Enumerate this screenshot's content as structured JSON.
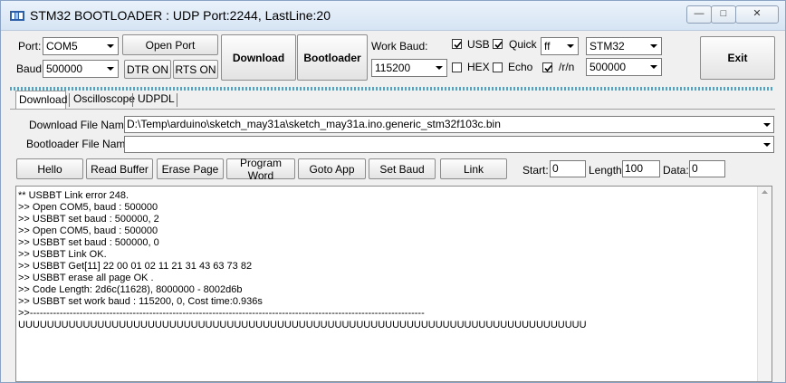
{
  "window": {
    "title": "STM32 BOOTLOADER : UDP Port:2244, LastLine:20",
    "minimize_glyph": "—",
    "maximize_glyph": "□",
    "close_glyph": "✕"
  },
  "toolbar": {
    "port_label": "Port:",
    "port_value": "COM5",
    "baud_label": "Baud:",
    "baud_value": "500000",
    "open_port_label": "Open Port",
    "dtr_label": "DTR ON",
    "rts_label": "RTS ON",
    "download_label": "Download",
    "bootloader_label": "Bootloader",
    "work_baud_label": "Work Baud:",
    "work_baud_value": "115200",
    "usb_label": "USB",
    "usb_checked": true,
    "quick_label": "Quick",
    "quick_checked": true,
    "quick_value": "ff",
    "hex_label": "HEX",
    "hex_checked": false,
    "echo_label": "Echo",
    "echo_checked": false,
    "rn_label": "/r/n",
    "rn_checked": true,
    "chip_value": "STM32",
    "chip_baud_value": "500000",
    "exit_label": "Exit"
  },
  "tabs": [
    {
      "label": "Download",
      "active": true
    },
    {
      "label": "Oscilloscope",
      "active": false
    },
    {
      "label": "UDPDL",
      "active": false
    }
  ],
  "files": {
    "download_label": "Download File Name:",
    "download_value": "D:\\Temp\\arduino\\sketch_may31a\\sketch_may31a.ino.generic_stm32f103c.bin",
    "bootloader_label": "Bootloader File Name:",
    "bootloader_value": ""
  },
  "actions": {
    "hello": "Hello",
    "read_buffer": "Read Buffer",
    "erase_page": "Erase Page",
    "program_word": "Program Word",
    "goto_app": "Goto App",
    "set_baud": "Set Baud",
    "link": "Link",
    "start_label": "Start:",
    "start_value": "0",
    "length_label": "Length:",
    "length_value": "100",
    "data_label": "Data:",
    "data_value": "0"
  },
  "log": [
    "** USBBT Link error 248.",
    ">> Open COM5, baud : 500000",
    ">> USBBT set baud : 500000, 2",
    ">> Open COM5, baud : 500000",
    ">> USBBT set baud : 500000, 0",
    ">> USBBT Link OK.",
    ">> USBBT Get[11] 22 00 01 02 11 21 31 43 63 73 82",
    ">> USBBT erase all page OK .",
    ">> Code Length: 2d6c(11628), 8000000 - 8002d6b",
    ">> USBBT set work baud : 115200, 0, Cost time:0.936s",
    ">>-----------------------------------------------------------------------------------------------------------------------",
    "UUUUUUUUUUUUUUUUUUUUUUUUUUUUUUUUUUUUUUUUUUUUUUUUUUUUUUUUUUUUUUUUUUUUUUUUUUUUUUU"
  ]
}
